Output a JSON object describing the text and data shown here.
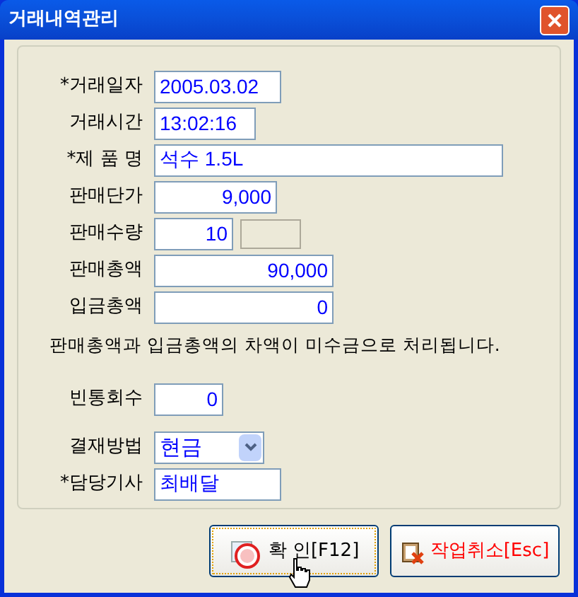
{
  "window": {
    "title": "거래내역관리"
  },
  "fields": [
    {
      "label": "*거래일자",
      "value": "2005.03.02",
      "kind": "text"
    },
    {
      "label": "거래시간",
      "value": "13:02:16",
      "kind": "text"
    },
    {
      "label": "*제 품 명",
      "value": "석수 1.5L",
      "kind": "text"
    },
    {
      "label": "판매단가",
      "value": "9,000",
      "kind": "number"
    },
    {
      "label": "판매수량",
      "value": "10",
      "kind": "number",
      "extra_field": {
        "disabled": true
      }
    },
    {
      "label": "판매총액",
      "value": "90,000",
      "kind": "number"
    },
    {
      "label": "입금총액",
      "value": "0",
      "kind": "number"
    },
    {
      "kind": "note",
      "text": "판매총액과 입금총액의 차액이 미수금으로 처리됩니다."
    },
    {
      "label": "빈통회수",
      "value": "0",
      "kind": "number"
    },
    {
      "label": "결재방법",
      "value": "현금",
      "kind": "select"
    },
    {
      "label": "*담당기사",
      "value": "최배달",
      "kind": "text"
    }
  ],
  "buttons": [
    {
      "label": "확 인[F12]",
      "kind": "confirm",
      "focused": true
    },
    {
      "label": "작업취소[Esc]",
      "kind": "cancel",
      "focused": false
    }
  ]
}
